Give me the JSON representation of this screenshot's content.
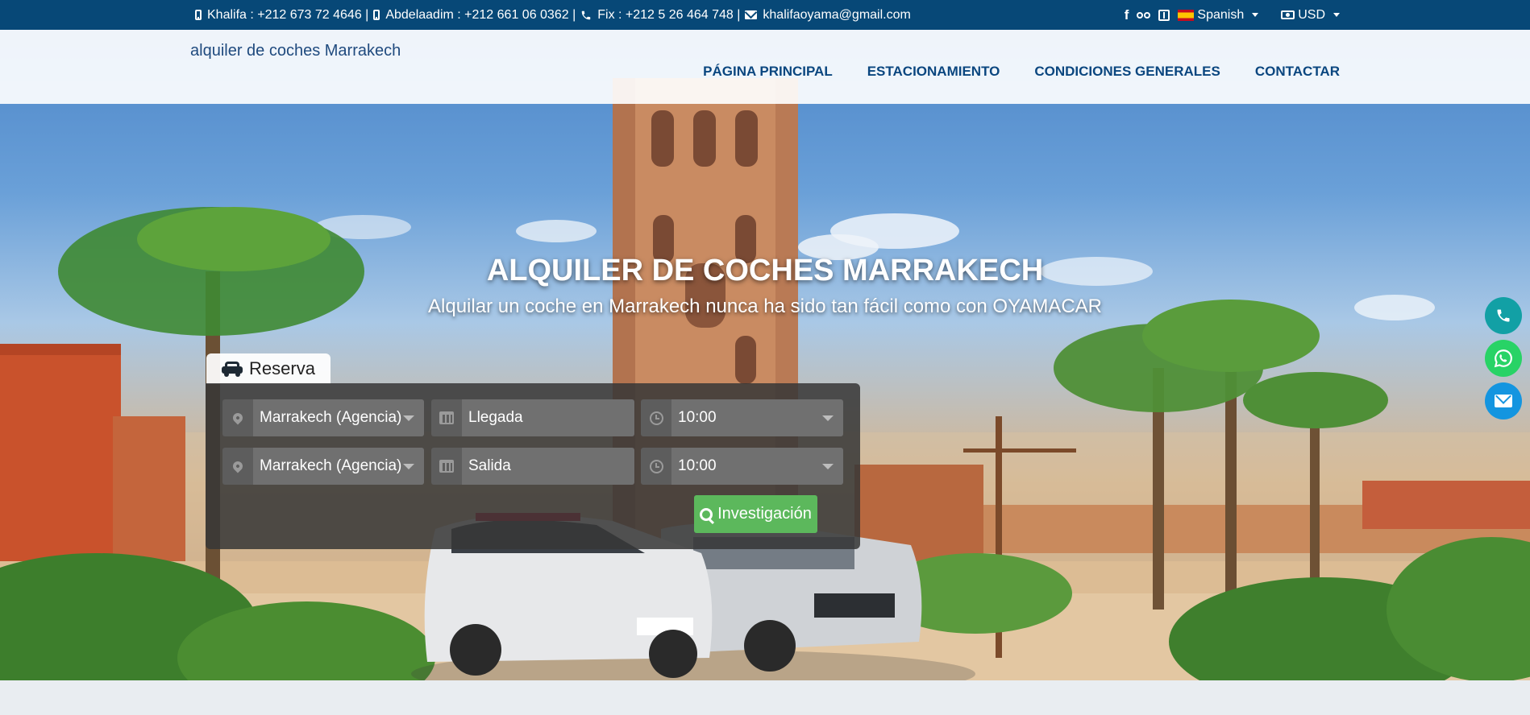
{
  "topbar": {
    "contacts": [
      {
        "icon": "mobile-icon",
        "text": "Khalifa : +212 673 72 4646 |"
      },
      {
        "icon": "mobile-icon",
        "text": "Abdelaadim : +212 661 06 0362 |"
      },
      {
        "icon": "phone-icon",
        "text": "Fix : +212 5 26 464 748 |"
      },
      {
        "icon": "envelope-icon",
        "text": "khalifaoyama@gmail.com"
      }
    ],
    "social": [
      "facebook-icon",
      "tripadvisor-icon",
      "guide-book-icon"
    ],
    "language": "Spanish",
    "currency": "USD"
  },
  "nav": {
    "brand": "alquiler de coches Marrakech",
    "links": [
      "PÁGINA PRINCIPAL",
      "ESTACIONAMIENTO",
      "CONDICIONES GENERALES",
      "CONTACTAR"
    ]
  },
  "hero": {
    "title": "ALQUILER DE COCHES MARRAKECH",
    "subtitle": "Alquilar un coche en Marrakech nunca ha sido tan fácil como con OYAMACAR"
  },
  "booking": {
    "tab_label": "Reserva",
    "pickup_location": "Marrakech (Agencia)",
    "pickup_date_placeholder": "Llegada",
    "pickup_time": "10:00",
    "return_location": "Marrakech (Agencia)",
    "return_date_placeholder": "Salida",
    "return_time": "10:00",
    "search_label": "Investigación"
  },
  "floating_buttons": [
    "phone-icon",
    "whatsapp-icon",
    "envelope-icon"
  ],
  "colors": {
    "topbar": "#074877",
    "nav_link": "#0a467f",
    "search_button": "#5cb85c",
    "phone_button": "#12a0a5",
    "whatsapp_button": "#28d366",
    "mail_button": "#1495e0"
  }
}
